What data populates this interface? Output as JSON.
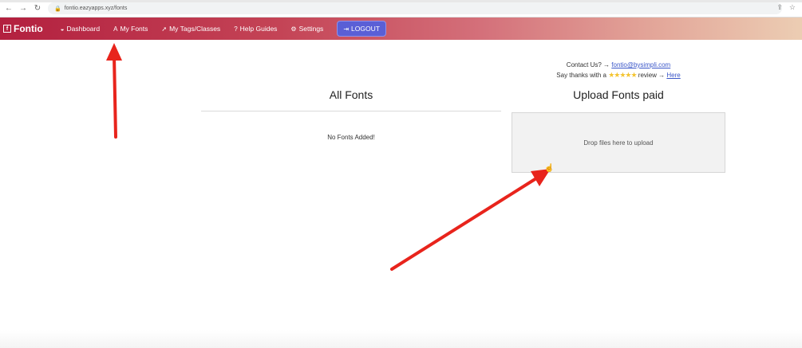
{
  "browser": {
    "url": "fontio.eazyapps.xyz/fonts"
  },
  "nav": {
    "brand": "Fontio",
    "items": [
      {
        "label": "Dashboard",
        "icon": "dashboard-icon"
      },
      {
        "label": "My Fonts",
        "icon": "font-icon"
      },
      {
        "label": "My Tags/Classes",
        "icon": "rocket-icon"
      },
      {
        "label": "Help Guides",
        "icon": "question-icon"
      },
      {
        "label": "Settings",
        "icon": "gear-icon"
      }
    ],
    "logout_label": "LOGOUT"
  },
  "contact": {
    "line1_prefix": "Contact Us? →",
    "email": "fontio@bysimpli.com",
    "line2_prefix": "Say thanks with a",
    "line2_suffix": "review →",
    "here_link": "Here"
  },
  "all_fonts": {
    "title": "All Fonts",
    "empty_message": "No Fonts Added!"
  },
  "upload": {
    "title": "Upload Fonts paid",
    "dropzone_text": "Drop files here to upload"
  },
  "colors": {
    "nav_gradient_start": "#b3203f",
    "nav_gradient_end": "#eccdb3",
    "logout_bg": "#5a5fd6",
    "annotation_arrow": "#e8241c"
  }
}
